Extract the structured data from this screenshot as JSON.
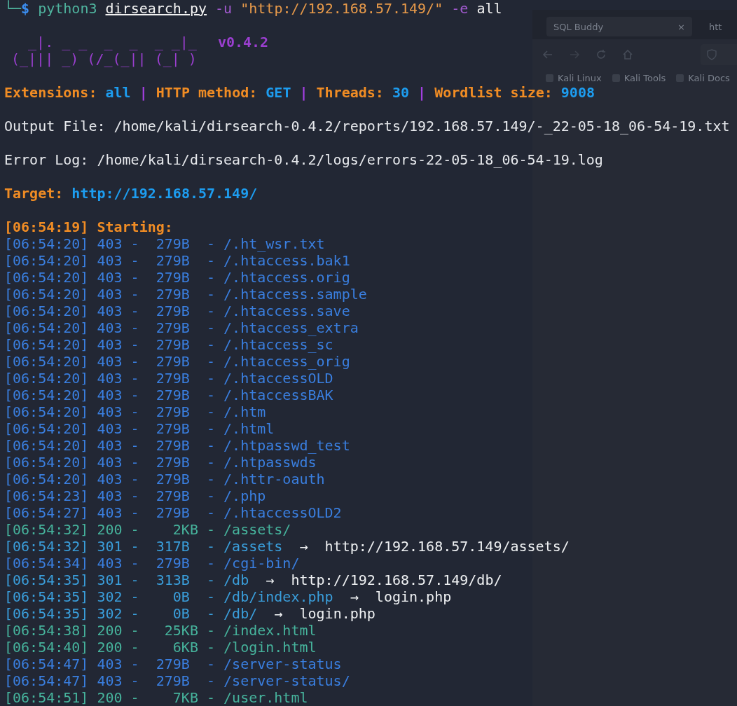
{
  "browser_window": {
    "tabs": [
      {
        "label": "SQL Buddy",
        "close": "×",
        "selected": true
      },
      {
        "label": "htt",
        "selected": false
      }
    ],
    "bookmarks": [
      "Kali Linux",
      "Kali Tools",
      "Kali Docs"
    ]
  },
  "prompt": {
    "symbol": "└─",
    "dollar": "$",
    "command": [
      {
        "text": "python3",
        "kind": "program"
      },
      {
        "text": "dirsearch.py",
        "kind": "file"
      },
      {
        "text": "-u",
        "kind": "flag"
      },
      {
        "text": "\"http://192.168.57.149/\"",
        "kind": "string"
      },
      {
        "text": "-e",
        "kind": "flag"
      },
      {
        "text": "all",
        "kind": "plain"
      }
    ]
  },
  "banner": {
    "art": [
      "  _|. _ _  _  _  _ _|_",
      "(_||| _) (/_(_|| (_| )"
    ],
    "version": "v0.4.2"
  },
  "config": {
    "separator": "|",
    "items": [
      {
        "label": "Extensions:",
        "value": "all"
      },
      {
        "label": "HTTP method:",
        "value": "GET"
      },
      {
        "label": "Threads:",
        "value": "30"
      },
      {
        "label": "Wordlist size:",
        "value": "9008"
      }
    ]
  },
  "output_file": "Output File: /home/kali/dirsearch-0.4.2/reports/192.168.57.149/-_22-05-18_06-54-19.txt",
  "error_log": "Error Log: /home/kali/dirsearch-0.4.2/logs/errors-22-05-18_06-54-19.log",
  "target": {
    "label": "Target:",
    "url": "http://192.168.57.149/"
  },
  "starting": "[06:54:19] Starting:",
  "results": [
    {
      "text": "[06:54:20] 403 -  279B  - /.ht_wsr.txt",
      "kind": "forbidden"
    },
    {
      "text": "[06:54:20] 403 -  279B  - /.htaccess.bak1",
      "kind": "forbidden"
    },
    {
      "text": "[06:54:20] 403 -  279B  - /.htaccess.orig",
      "kind": "forbidden"
    },
    {
      "text": "[06:54:20] 403 -  279B  - /.htaccess.sample",
      "kind": "forbidden"
    },
    {
      "text": "[06:54:20] 403 -  279B  - /.htaccess.save",
      "kind": "forbidden"
    },
    {
      "text": "[06:54:20] 403 -  279B  - /.htaccess_extra",
      "kind": "forbidden"
    },
    {
      "text": "[06:54:20] 403 -  279B  - /.htaccess_sc",
      "kind": "forbidden"
    },
    {
      "text": "[06:54:20] 403 -  279B  - /.htaccess_orig",
      "kind": "forbidden"
    },
    {
      "text": "[06:54:20] 403 -  279B  - /.htaccessOLD",
      "kind": "forbidden"
    },
    {
      "text": "[06:54:20] 403 -  279B  - /.htaccessBAK",
      "kind": "forbidden"
    },
    {
      "text": "[06:54:20] 403 -  279B  - /.htm",
      "kind": "forbidden"
    },
    {
      "text": "[06:54:20] 403 -  279B  - /.html",
      "kind": "forbidden"
    },
    {
      "text": "[06:54:20] 403 -  279B  - /.htpasswd_test",
      "kind": "forbidden"
    },
    {
      "text": "[06:54:20] 403 -  279B  - /.htpasswds",
      "kind": "forbidden"
    },
    {
      "text": "[06:54:20] 403 -  279B  - /.httr-oauth",
      "kind": "forbidden"
    },
    {
      "text": "[06:54:23] 403 -  279B  - /.php",
      "kind": "forbidden"
    },
    {
      "text": "[06:54:27] 403 -  279B  - /.htaccessOLD2",
      "kind": "forbidden"
    },
    {
      "text": "[06:54:32] 200 -    2KB - /assets/",
      "kind": "ok"
    },
    {
      "text": "[06:54:32] 301 -  317B  - /assets",
      "kind": "redirect",
      "arrow": "→",
      "redirect": "http://192.168.57.149/assets/"
    },
    {
      "text": "[06:54:34] 403 -  279B  - /cgi-bin/",
      "kind": "forbidden"
    },
    {
      "text": "[06:54:35] 301 -  313B  - /db",
      "kind": "redirect",
      "arrow": "→",
      "redirect": "http://192.168.57.149/db/"
    },
    {
      "text": "[06:54:35] 302 -    0B  - /db/index.php",
      "kind": "redirect",
      "arrow": "→",
      "redirect": "login.php"
    },
    {
      "text": "[06:54:35] 302 -    0B  - /db/",
      "kind": "redirect",
      "arrow": "→",
      "redirect": "login.php"
    },
    {
      "text": "[06:54:38] 200 -   25KB - /index.html",
      "kind": "ok"
    },
    {
      "text": "[06:54:40] 200 -    6KB - /login.html",
      "kind": "ok"
    },
    {
      "text": "[06:54:47] 403 -  279B  - /server-status",
      "kind": "forbidden"
    },
    {
      "text": "[06:54:47] 403 -  279B  - /server-status/",
      "kind": "forbidden"
    },
    {
      "text": "[06:54:51] 200 -    7KB - /user.html",
      "kind": "ok"
    }
  ]
}
